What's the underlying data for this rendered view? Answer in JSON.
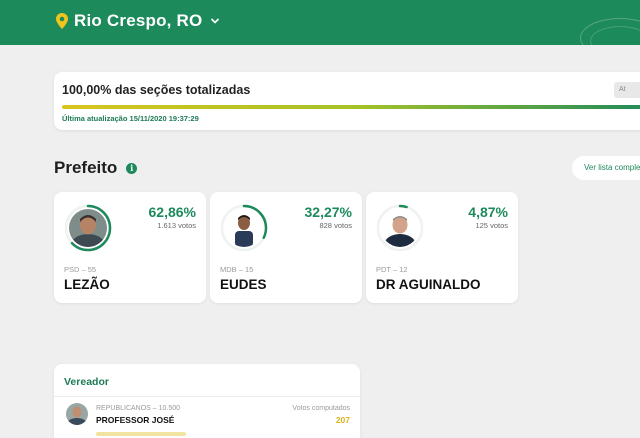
{
  "header": {
    "location": "Rio Crespo, RO",
    "background_color": "#1d8a5c",
    "pin_icon": "map-pin-icon",
    "dropdown_icon": "chevron-down-icon"
  },
  "progress": {
    "title": "100,00% das seções totalizadas",
    "percent": 100,
    "updated": "Última atualização 15/11/2020 19:37:29",
    "corner_button": "At"
  },
  "mayor": {
    "title": "Prefeito",
    "see_all": "Ver lista comple",
    "candidates": [
      {
        "percent": "62,86%",
        "votes": "1.613 votos",
        "party": "PSD – 55",
        "name": "LEZÃO",
        "share": 0.6286
      },
      {
        "percent": "32,27%",
        "votes": "828 votos",
        "party": "MDB – 15",
        "name": "EUDES",
        "share": 0.3227
      },
      {
        "percent": "4,87%",
        "votes": "125 votos",
        "party": "PDT – 12",
        "name": "DR AGUINALDO",
        "share": 0.0487
      }
    ]
  },
  "councilor": {
    "title": "Vereador",
    "item": {
      "party": "REPUBLICANOS – 10.500",
      "name": "PROFESSOR JOSÉ",
      "votes_label": "Votos computados",
      "votes": "207"
    }
  },
  "colors": {
    "accent": "#1d8a5c",
    "gold": "#d7b420"
  }
}
